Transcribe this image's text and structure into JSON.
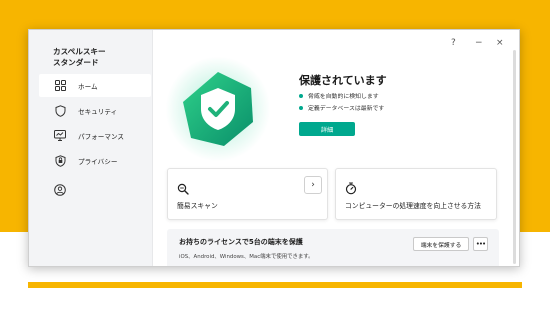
{
  "app": {
    "brand_line1": "カスペルスキー",
    "brand_line2": "スタンダード"
  },
  "window_controls": {
    "help": "?",
    "minimize": "−",
    "close": "×"
  },
  "sidebar": {
    "items": [
      {
        "label": "ホーム",
        "icon": "home-icon",
        "active": true
      },
      {
        "label": "セキュリティ",
        "icon": "shield-icon",
        "active": false
      },
      {
        "label": "パフォーマンス",
        "icon": "monitor-icon",
        "active": false
      },
      {
        "label": "プライバシー",
        "icon": "privacy-shield-icon",
        "active": false
      },
      {
        "label": "",
        "icon": "user-icon",
        "active": false
      }
    ]
  },
  "hero": {
    "title": "保護されています",
    "status": [
      "脅威を自動的に検知します",
      "定義データベースは最新です"
    ],
    "details_button": "詳細"
  },
  "cards": {
    "quick_scan": {
      "label": "簡易スキャン",
      "icon": "scan-icon",
      "arrow": "›"
    },
    "speed_up": {
      "label": "コンピューターの処理速度を向上させる方法",
      "icon": "stopwatch-icon"
    }
  },
  "banner": {
    "title": "お持ちのライセンスで5台の端末を保護",
    "subtitle": "iOS、Android、Windows、Mac端末で使用できます。",
    "protect_button": "端末を保護する",
    "more_button": "•••"
  },
  "colors": {
    "accent": "#00a88e",
    "background_yellow": "#f7b500",
    "shield_green": "#1fb27a"
  }
}
